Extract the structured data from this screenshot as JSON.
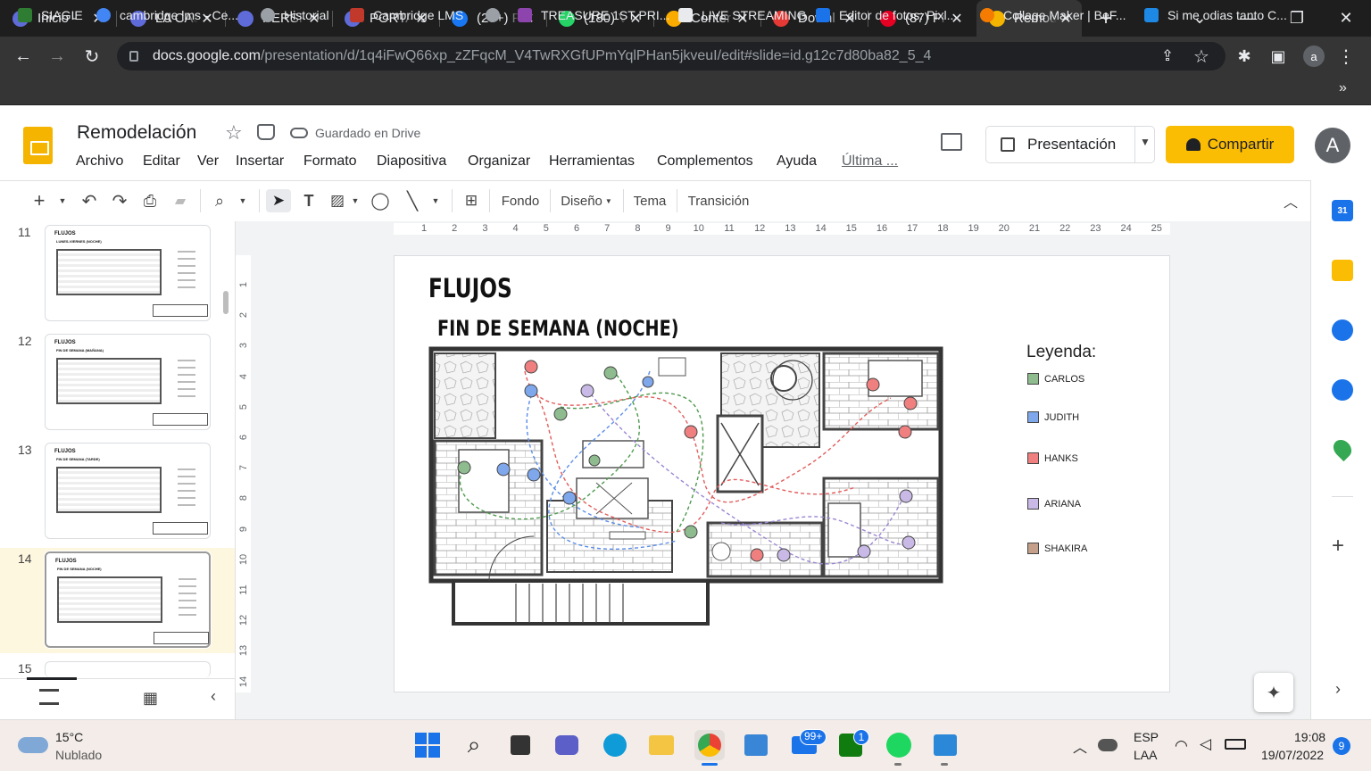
{
  "browser": {
    "tabs": [
      {
        "title": "Inicio - ",
        "icon": "canva-icon",
        "color": "#5f6bd8"
      },
      {
        "title": "LA CAS",
        "icon": "canva-icon",
        "color": "#5f6bd8"
      },
      {
        "title": "PERSP",
        "icon": "canva-icon",
        "color": "#5f6bd8"
      },
      {
        "title": "PORTA",
        "icon": "canva-icon",
        "color": "#5f6bd8"
      },
      {
        "title": "(20+) F",
        "icon": "facebook-icon",
        "color": "#1877f2"
      },
      {
        "title": "(180) V",
        "icon": "whatsapp-icon",
        "color": "#25d366"
      },
      {
        "title": "Conter",
        "icon": "edit-icon",
        "color": "#f9ab00"
      },
      {
        "title": "Downl",
        "icon": "heart-icon",
        "color": "#e53935"
      },
      {
        "title": "(87) Pi",
        "icon": "pinterest-icon",
        "color": "#e60023"
      },
      {
        "title": "Remod",
        "icon": "slides-icon",
        "color": "#f4b400"
      }
    ],
    "url_domain": "docs.google.com",
    "url_path": "/presentation/d/1q4iFwQ66xp_zZFqcM_V4TwRXGfUPmYqlPHan5jkveuI/edit#slide=id.g12c7d80ba82_5_4",
    "bookmarks": [
      {
        "label": "SIAGIE",
        "icon": "siagie-icon",
        "color": "#2e7d32"
      },
      {
        "label": "cambridge lms - Ce...",
        "icon": "google-icon",
        "color": "#4285f4"
      },
      {
        "label": "Historial",
        "icon": "history-icon",
        "color": "#9aa0a6"
      },
      {
        "label": "Cambridge LMS",
        "icon": "cambridge-icon",
        "color": "#c0392b"
      },
      {
        "label": "",
        "icon": "globe-icon",
        "color": "#9aa0a6"
      },
      {
        "label": "TREASURE 1ST PRI...",
        "icon": "bookmark-icon",
        "color": "#8e44ad"
      },
      {
        "label": "LIVE STREAMING",
        "icon": "stream-icon",
        "color": "#e8eaed"
      },
      {
        "label": "Editor de fotos: Pixl...",
        "icon": "pixlr-icon",
        "color": "#1a73e8"
      },
      {
        "label": "Collage Maker | BeF...",
        "icon": "befunky-icon",
        "color": "#f57c00"
      },
      {
        "label": "Si me odias tanto C...",
        "icon": "page-icon",
        "color": "#1e88e5"
      }
    ]
  },
  "app": {
    "doc_title": "Remodelación",
    "save_status": "Guardado en Drive",
    "menus": [
      "Archivo",
      "Editar",
      "Ver",
      "Insertar",
      "Formato",
      "Diapositiva",
      "Organizar",
      "Herramientas",
      "Complementos",
      "Ayuda"
    ],
    "last_edit": "Última ...",
    "present_label": "Presentación",
    "share_label": "Compartir",
    "avatar_letter": "A",
    "toolbar": {
      "background": "Fondo",
      "layout": "Diseño",
      "theme": "Tema",
      "transition": "Transición"
    }
  },
  "filmstrip": {
    "slides": [
      {
        "num": "11",
        "title": "FLUJOS",
        "subtitle": "LUNES-VIERNES (NOCHE)"
      },
      {
        "num": "12",
        "title": "FLUJOS",
        "subtitle": "FIN DE SEMANA (MAÑANA)"
      },
      {
        "num": "13",
        "title": "FLUJOS",
        "subtitle": "FIN DE SEMANA (TARDE)"
      },
      {
        "num": "14",
        "title": "FLUJOS",
        "subtitle": "FIN DE SEMANA (NOCHE)"
      },
      {
        "num": "15",
        "title": "",
        "subtitle": ""
      }
    ]
  },
  "ruler": {
    "h": [
      "1",
      "2",
      "3",
      "4",
      "5",
      "6",
      "7",
      "8",
      "9",
      "10",
      "11",
      "12",
      "13",
      "14",
      "15",
      "16",
      "17",
      "18",
      "19",
      "20",
      "21",
      "22",
      "23",
      "24",
      "25"
    ],
    "v": [
      "1",
      "2",
      "3",
      "4",
      "5",
      "6",
      "7",
      "8",
      "9",
      "10",
      "11",
      "12",
      "13",
      "14"
    ]
  },
  "slide": {
    "title": "FLUJOS",
    "subtitle": "FIN DE SEMANA (NOCHE)",
    "legend_title": "Leyenda:",
    "legend": [
      {
        "name": "CARLOS",
        "color": "#8fbc8f"
      },
      {
        "name": "JUDITH",
        "color": "#7ea7ec"
      },
      {
        "name": "HANKS",
        "color": "#f08080"
      },
      {
        "name": "ARIANA",
        "color": "#c9b9e6"
      },
      {
        "name": "SHAKIRA",
        "color": "#c4a08a"
      }
    ]
  },
  "taskbar": {
    "temp": "15°C",
    "weather": "Nublado",
    "lang1": "ESP",
    "lang2": "LAA",
    "time": "19:08",
    "date": "19/07/2022",
    "mail_badge": "99+",
    "xbox_badge": "1",
    "notif_count": "9"
  }
}
